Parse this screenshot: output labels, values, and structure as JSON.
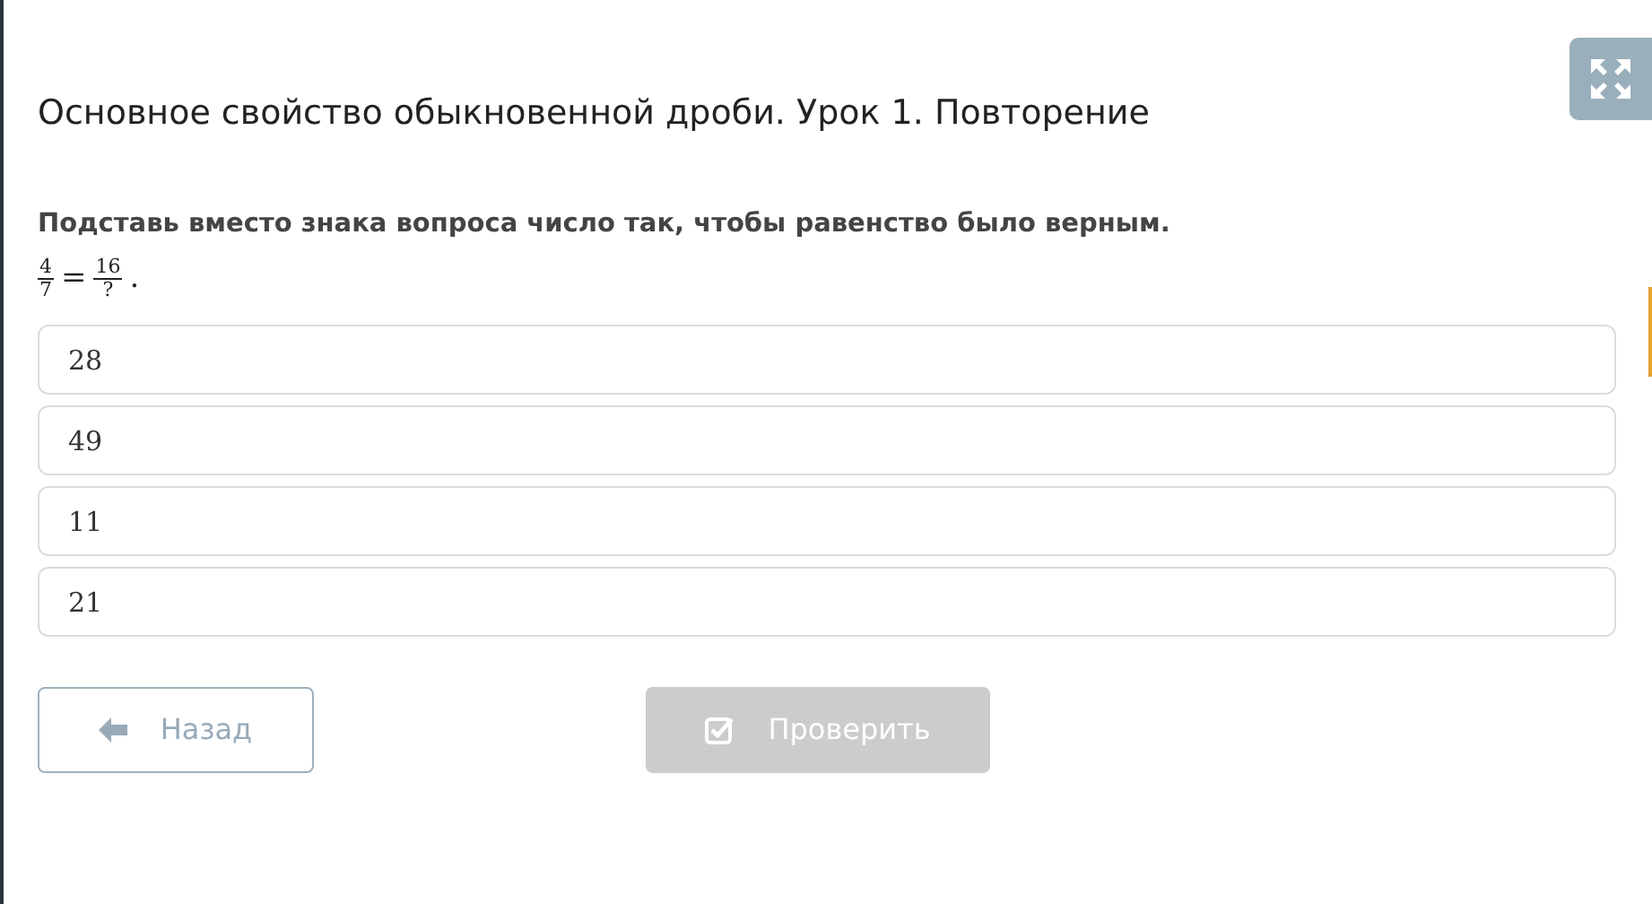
{
  "title": "Основное свойство обыкновенной дроби. Урок 1. Повторение",
  "question": "Подставь вместо знака вопроса число так, чтобы равенство было верным.",
  "equation": {
    "left": {
      "numerator": "4",
      "denominator": "7"
    },
    "sign": "=",
    "right": {
      "numerator": "16",
      "denominator": "?"
    },
    "end": "."
  },
  "options": [
    {
      "label": "28",
      "selected": false
    },
    {
      "label": "49",
      "selected": false
    },
    {
      "label": "11",
      "selected": false
    },
    {
      "label": "21",
      "selected": false
    }
  ],
  "buttons": [
    {
      "kind": "back",
      "label": "Назад"
    },
    {
      "kind": "check",
      "label": "Проверить",
      "disabled": true
    }
  ]
}
